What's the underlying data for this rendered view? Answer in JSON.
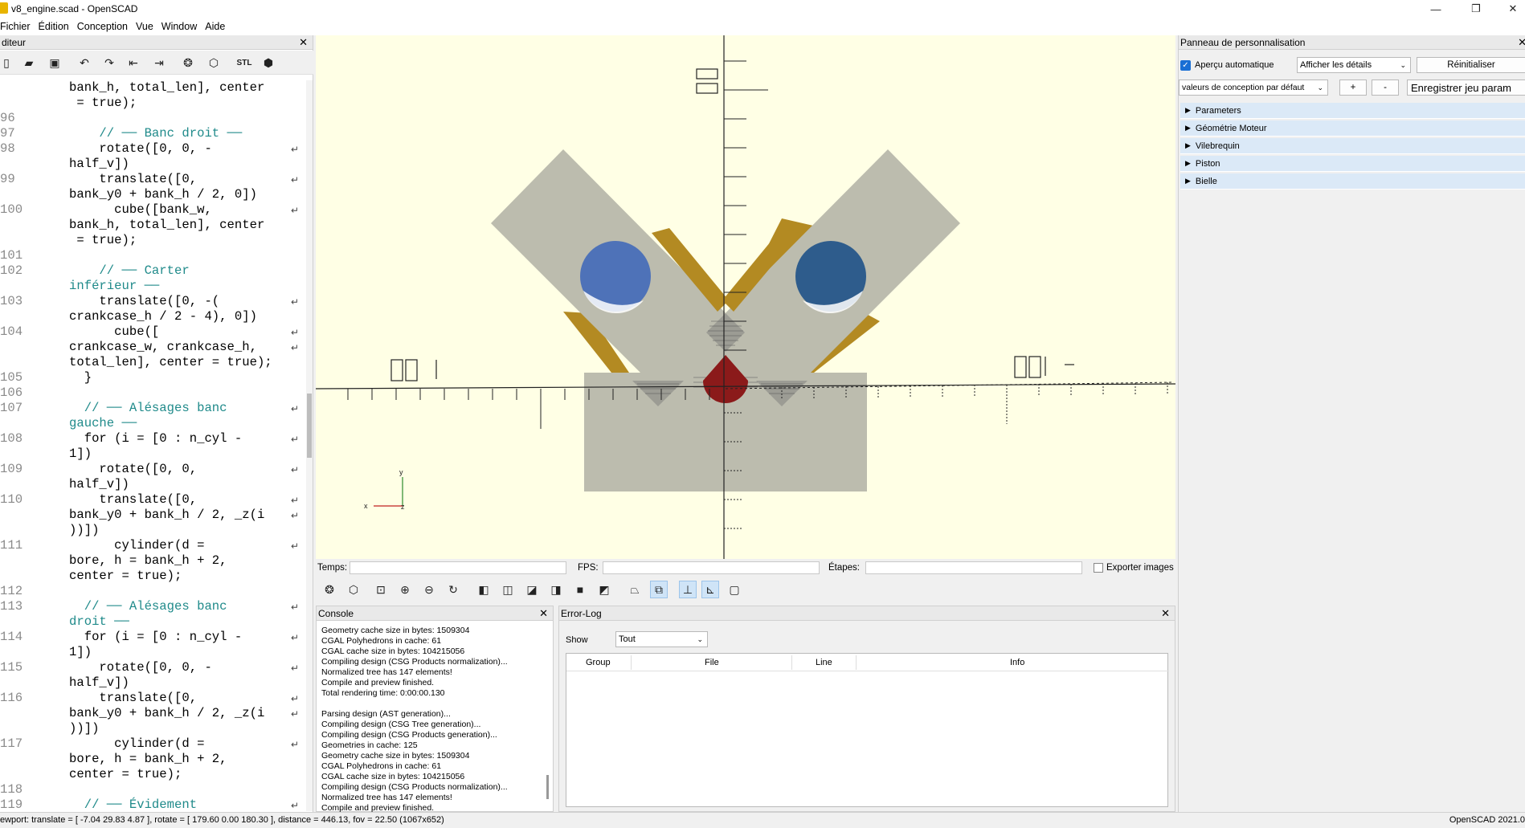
{
  "window": {
    "title": "v8_engine.scad - OpenSCAD"
  },
  "menu": [
    "Fichier",
    "Édition",
    "Conception",
    "Vue",
    "Window",
    "Aide"
  ],
  "editor": {
    "title": "diteur",
    "lines": [
      {
        "n": "",
        "t": "bank_h, total_len], center"
      },
      {
        "n": "",
        "t": " = true);"
      },
      {
        "n": "96",
        "t": ""
      },
      {
        "n": "97",
        "t": "    // ── Banc droit ──",
        "c": 1
      },
      {
        "n": "98",
        "t": "    rotate([0, 0, -",
        "w": 1
      },
      {
        "n": "",
        "t": "half_v])"
      },
      {
        "n": "99",
        "t": "    translate([0,",
        "w": 1
      },
      {
        "n": "",
        "t": "bank_y0 + bank_h / 2, 0])"
      },
      {
        "n": "100",
        "t": "      cube([bank_w,",
        "w": 1
      },
      {
        "n": "",
        "t": "bank_h, total_len], center"
      },
      {
        "n": "",
        "t": " = true);"
      },
      {
        "n": "101",
        "t": ""
      },
      {
        "n": "102",
        "t": "    // ── Carter",
        "c": 1
      },
      {
        "n": "",
        "t": "inférieur ──",
        "c": 1
      },
      {
        "n": "103",
        "t": "    translate([0, -(",
        "w": 1
      },
      {
        "n": "",
        "t": "crankcase_h / 2 - 4), 0])"
      },
      {
        "n": "104",
        "t": "      cube([",
        "w": 1
      },
      {
        "n": "",
        "t": "crankcase_w, crankcase_h,",
        "w": 1
      },
      {
        "n": "",
        "t": "total_len], center = true);"
      },
      {
        "n": "105",
        "t": "  }"
      },
      {
        "n": "106",
        "t": ""
      },
      {
        "n": "107",
        "t": "  // ── Alésages banc",
        "c": 1,
        "w": 1
      },
      {
        "n": "",
        "t": "gauche ──",
        "c": 1
      },
      {
        "n": "108",
        "t": "  for (i = [0 : n_cyl -",
        "w": 1
      },
      {
        "n": "",
        "t": "1])"
      },
      {
        "n": "109",
        "t": "    rotate([0, 0,",
        "w": 1
      },
      {
        "n": "",
        "t": "half_v])"
      },
      {
        "n": "110",
        "t": "    translate([0,",
        "w": 1
      },
      {
        "n": "",
        "t": "bank_y0 + bank_h / 2, _z(i",
        "w": 1
      },
      {
        "n": "",
        "t": "))])"
      },
      {
        "n": "111",
        "t": "      cylinder(d =",
        "w": 1
      },
      {
        "n": "",
        "t": "bore, h = bank_h + 2,"
      },
      {
        "n": "",
        "t": "center = true);"
      },
      {
        "n": "112",
        "t": ""
      },
      {
        "n": "113",
        "t": "  // ── Alésages banc",
        "c": 1,
        "w": 1
      },
      {
        "n": "",
        "t": "droit ──",
        "c": 1
      },
      {
        "n": "114",
        "t": "  for (i = [0 : n_cyl -",
        "w": 1
      },
      {
        "n": "",
        "t": "1])"
      },
      {
        "n": "115",
        "t": "    rotate([0, 0, -",
        "w": 1
      },
      {
        "n": "",
        "t": "half_v])"
      },
      {
        "n": "116",
        "t": "    translate([0,",
        "w": 1
      },
      {
        "n": "",
        "t": "bank_y0 + bank_h / 2, _z(i",
        "w": 1
      },
      {
        "n": "",
        "t": "))])"
      },
      {
        "n": "117",
        "t": "      cylinder(d =",
        "w": 1
      },
      {
        "n": "",
        "t": "bore, h = bank_h + 2,"
      },
      {
        "n": "",
        "t": "center = true);"
      },
      {
        "n": "118",
        "t": ""
      },
      {
        "n": "119",
        "t": "  // ── Évidement",
        "c": 1,
        "w": 1
      }
    ]
  },
  "timebar": {
    "temps": "Temps:",
    "fps": "FPS:",
    "etapes": "Étapes:",
    "export": "Exporter images"
  },
  "console": {
    "title": "Console",
    "lines": [
      "Geometry cache size in bytes: 1509304",
      "CGAL Polyhedrons in cache: 61",
      "CGAL cache size in bytes: 104215056",
      "Compiling design (CSG Products normalization)...",
      "Normalized tree has 147 elements!",
      "Compile and preview finished.",
      "Total rendering time: 0:00:00.130",
      "",
      "Parsing design (AST generation)...",
      "Compiling design (CSG Tree generation)...",
      "Compiling design (CSG Products generation)...",
      "Geometries in cache: 125",
      "Geometry cache size in bytes: 1509304",
      "CGAL Polyhedrons in cache: 61",
      "CGAL cache size in bytes: 104215056",
      "Compiling design (CSG Products normalization)...",
      "Normalized tree has 147 elements!",
      "Compile and preview finished."
    ]
  },
  "errorlog": {
    "title": "Error-Log",
    "show_label": "Show",
    "show_value": "Tout",
    "columns": [
      "Group",
      "File",
      "Line",
      "Info"
    ]
  },
  "customizer": {
    "title": "Panneau de personnalisation",
    "auto_preview": "Aperçu automatique",
    "details": "Afficher les détails",
    "reset": "Réinitialiser",
    "preset": "valeurs de conception par défaut",
    "plus": "+",
    "minus": "-",
    "save": "Enregistrer jeu param",
    "groups": [
      "Parameters",
      "Géométrie Moteur",
      "Vilebrequin",
      "Piston",
      "Bielle"
    ]
  },
  "status": {
    "left": "ewport: translate = [ -7.04 29.83 4.87 ], rotate = [ 179.60 0.00 180.30 ], distance = 446.13, fov = 22.50 (1067x652)",
    "right": "OpenSCAD 2021.0"
  },
  "colors": {
    "viewport_bg": "#ffffe5",
    "block": "#bcbcae",
    "gold": "#b38a22",
    "blue_left": "#4e72b8",
    "blue_right": "#2e5c8c",
    "red": "#8b1a1a"
  },
  "icons": [
    "new-icon",
    "open-icon",
    "save-icon",
    "undo-icon",
    "redo-icon",
    "unindent-icon",
    "indent-icon",
    "preview-icon",
    "render-icon",
    "export-stl-icon",
    "send-printer-icon"
  ]
}
